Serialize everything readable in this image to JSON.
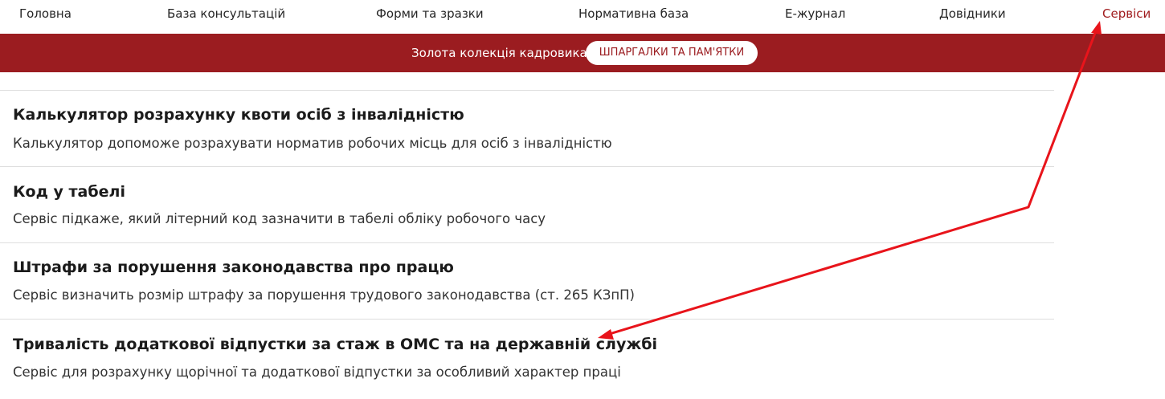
{
  "nav": {
    "items": [
      {
        "label": "Головна"
      },
      {
        "label": "База консультацій"
      },
      {
        "label": "Форми та зразки"
      },
      {
        "label": "Нормативна база"
      },
      {
        "label": "Е-журнал"
      },
      {
        "label": "Довідники"
      },
      {
        "label": "Сервіси"
      }
    ],
    "active_color": "#a01c1e"
  },
  "banner": {
    "text": "Золота колекція кадровика",
    "button_label": "ШПАРГАЛКИ ТА ПАМ'ЯТКИ",
    "background": "#9b1c20"
  },
  "services": [
    {
      "title": "Калькулятор розрахунку квоти осіб з інвалідністю",
      "description": "Калькулятор допоможе розрахувати норматив робочих місць для осіб з інвалідністю"
    },
    {
      "title": "Код у табелі",
      "description": "Сервіс підкаже, який літерний код зазначити в табелі обліку робочого часу"
    },
    {
      "title": "Штрафи за порушення законодавства про працю",
      "description": "Сервіс визначить розмір штрафу за порушення трудового законодавства (ст. 265 КЗпП)"
    },
    {
      "title": "Тривалість додаткової відпустки за стаж в ОМС та на державній службі",
      "description": "Сервіс для розрахунку щорічної та додаткової відпустки за особливий характер праці"
    }
  ],
  "annotation_color": "#e8141b"
}
